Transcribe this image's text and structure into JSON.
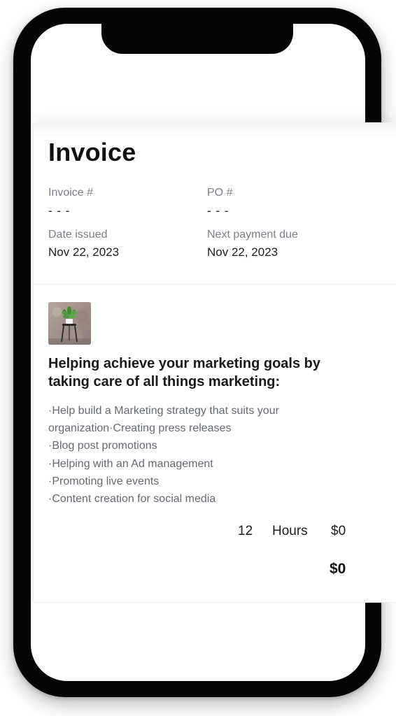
{
  "invoice": {
    "title": "Invoice",
    "invoice_number_label": "Invoice #",
    "invoice_number_value": "- - -",
    "po_label": "PO #",
    "po_value": "- - -",
    "date_issued_label": "Date issued",
    "date_issued_value": "Nov 22, 2023",
    "next_payment_label": "Next payment due",
    "next_payment_value": "Nov 22, 2023"
  },
  "line_item": {
    "image_icon": "plant-on-stand-image",
    "heading": "Helping achieve your marketing goals by taking care of all things marketing:",
    "description_lines": [
      "·Help build a Marketing strategy that suits your",
      "organization·Creating press releases",
      "·Blog post promotions",
      "·Helping with an Ad management",
      "·Promoting live events",
      "·Content creation for social media"
    ],
    "quantity": "12",
    "unit": "Hours",
    "price": "$0",
    "total": "$0"
  },
  "colors": {
    "phone_frame": "#050505",
    "muted_text": "#7a7f88",
    "body_text": "#1c1c1c",
    "divider": "#ececec"
  }
}
